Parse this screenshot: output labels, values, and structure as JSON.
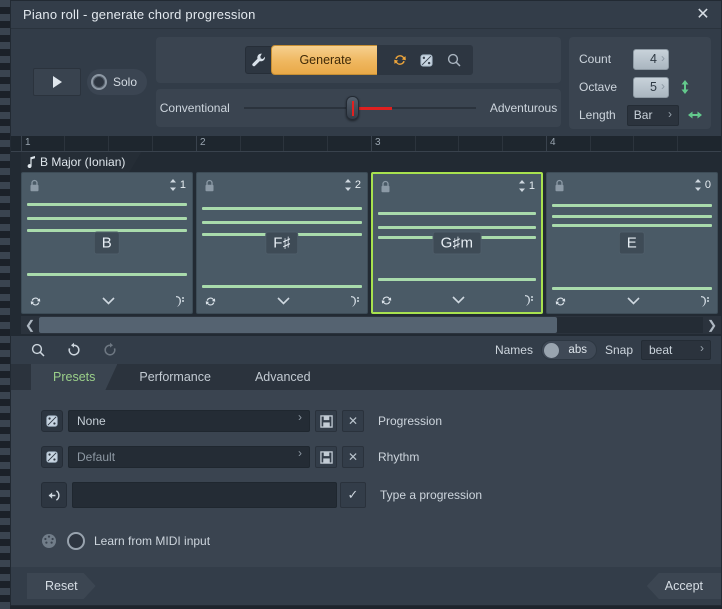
{
  "window": {
    "title": "Piano roll - generate chord progression",
    "close_icon": "close-icon"
  },
  "transport": {
    "play_icon": "play-icon",
    "solo_label": "Solo"
  },
  "generate": {
    "wrench_icon": "wrench-icon",
    "button_label": "Generate",
    "refresh_icon": "refresh-icon",
    "dice_icon": "dice-icon",
    "magnifier_icon": "magnifier-icon"
  },
  "slider": {
    "left_label": "Conventional",
    "right_label": "Adventurous",
    "value_percent": 46
  },
  "params": {
    "count_label": "Count",
    "count_value": "4",
    "octave_label": "Octave",
    "octave_value": "5",
    "octave_arrow_icon": "vertical-arrows-icon",
    "length_label": "Length",
    "length_value": "Bar",
    "length_arrow_icon": "horizontal-arrows-icon"
  },
  "timeline": {
    "key_note_icon": "music-note-icon",
    "key_label": "B Major (Ionian)",
    "bars": [
      "1",
      "2",
      "3",
      "4"
    ]
  },
  "chords": [
    {
      "name": "B",
      "inversion": "1",
      "selected": false,
      "lock_icon": "lock-icon",
      "note_lines": [
        30,
        44,
        56,
        100
      ],
      "refresh_icon": "refresh-icon",
      "chevron_icon": "chevron-down-icon",
      "clef_icon": "bass-clef-icon"
    },
    {
      "name": "F♯",
      "inversion": "2",
      "selected": false,
      "lock_icon": "lock-icon",
      "note_lines": [
        34,
        48,
        60,
        112
      ],
      "refresh_icon": "refresh-icon",
      "chevron_icon": "chevron-down-icon",
      "clef_icon": "bass-clef-icon"
    },
    {
      "name": "G♯m",
      "inversion": "1",
      "selected": true,
      "lock_icon": "lock-icon",
      "note_lines": [
        38,
        52,
        62,
        104
      ],
      "refresh_icon": "refresh-icon",
      "chevron_icon": "chevron-down-icon",
      "clef_icon": "bass-clef-icon"
    },
    {
      "name": "E",
      "inversion": "0",
      "selected": false,
      "lock_icon": "lock-icon",
      "note_lines": [
        31,
        42,
        51,
        114
      ],
      "refresh_icon": "refresh-icon",
      "chevron_icon": "chevron-down-icon",
      "clef_icon": "bass-clef-icon"
    }
  ],
  "scrollbar": {
    "left_icon": "chevron-left-icon",
    "right_icon": "chevron-right-icon",
    "thumb_percent": 78
  },
  "toolbar": {
    "zoom_icon": "magnifier-icon",
    "undo_icon": "undo-icon",
    "redo_icon": "redo-icon",
    "names_label": "Names",
    "names_value": "abs",
    "snap_label": "Snap",
    "snap_value": "beat"
  },
  "tabs": [
    {
      "label": "Presets",
      "active": true
    },
    {
      "label": "Performance",
      "active": false
    },
    {
      "label": "Advanced",
      "active": false
    }
  ],
  "presets": {
    "progression": {
      "dice_icon": "dice-icon",
      "value": "None",
      "save_icon": "save-icon",
      "delete_icon": "close-icon",
      "label": "Progression"
    },
    "rhythm": {
      "dice_icon": "dice-icon",
      "value": "Default",
      "save_icon": "save-icon",
      "delete_icon": "close-icon",
      "label": "Rhythm"
    },
    "type_progression": {
      "enter_icon": "enter-arrow-icon",
      "value": "",
      "placeholder": "",
      "confirm_icon": "check-icon",
      "label": "Type a progression"
    },
    "midi_learn": {
      "midi_icon": "midi-port-icon",
      "toggle_icon": "radio-knob-icon",
      "label": "Learn from MIDI input"
    }
  },
  "footer": {
    "reset_label": "Reset",
    "accept_label": "Accept"
  }
}
